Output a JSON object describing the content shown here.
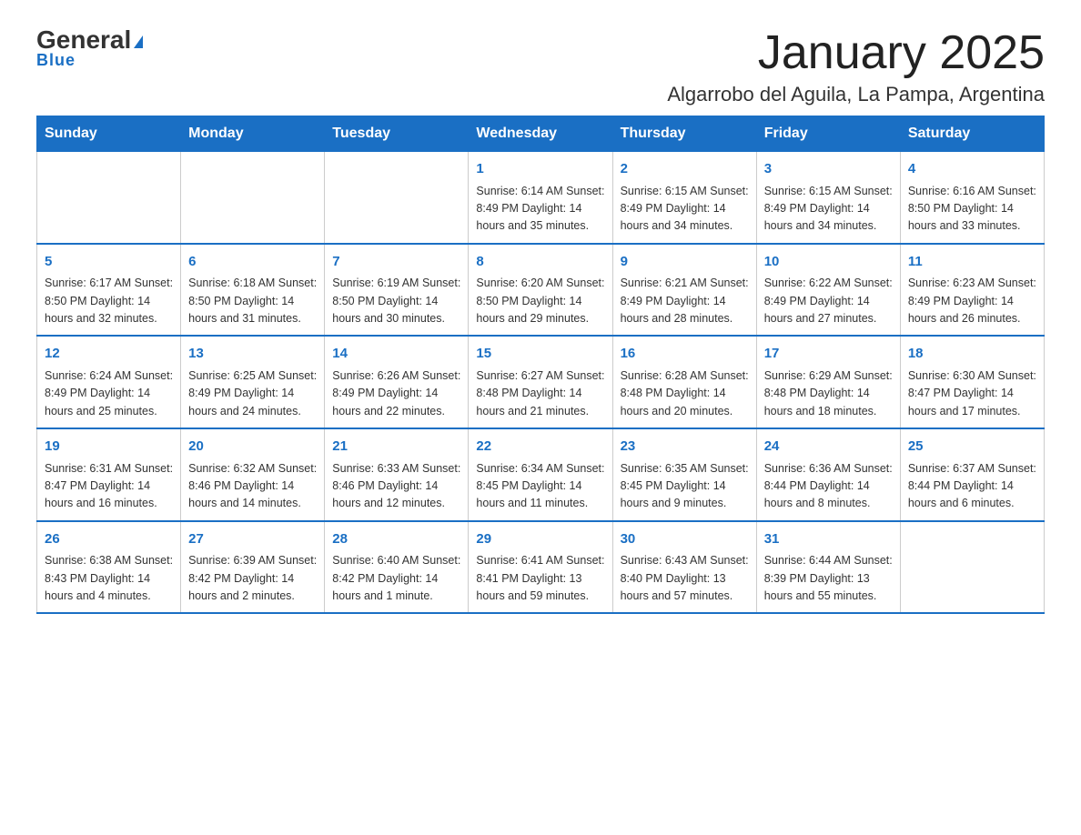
{
  "header": {
    "logo_general": "General",
    "logo_blue": "Blue",
    "title": "January 2025",
    "subtitle": "Algarrobo del Aguila, La Pampa, Argentina"
  },
  "days_of_week": [
    "Sunday",
    "Monday",
    "Tuesday",
    "Wednesday",
    "Thursday",
    "Friday",
    "Saturday"
  ],
  "weeks": [
    [
      {
        "day": "",
        "info": ""
      },
      {
        "day": "",
        "info": ""
      },
      {
        "day": "",
        "info": ""
      },
      {
        "day": "1",
        "info": "Sunrise: 6:14 AM\nSunset: 8:49 PM\nDaylight: 14 hours\nand 35 minutes."
      },
      {
        "day": "2",
        "info": "Sunrise: 6:15 AM\nSunset: 8:49 PM\nDaylight: 14 hours\nand 34 minutes."
      },
      {
        "day": "3",
        "info": "Sunrise: 6:15 AM\nSunset: 8:49 PM\nDaylight: 14 hours\nand 34 minutes."
      },
      {
        "day": "4",
        "info": "Sunrise: 6:16 AM\nSunset: 8:50 PM\nDaylight: 14 hours\nand 33 minutes."
      }
    ],
    [
      {
        "day": "5",
        "info": "Sunrise: 6:17 AM\nSunset: 8:50 PM\nDaylight: 14 hours\nand 32 minutes."
      },
      {
        "day": "6",
        "info": "Sunrise: 6:18 AM\nSunset: 8:50 PM\nDaylight: 14 hours\nand 31 minutes."
      },
      {
        "day": "7",
        "info": "Sunrise: 6:19 AM\nSunset: 8:50 PM\nDaylight: 14 hours\nand 30 minutes."
      },
      {
        "day": "8",
        "info": "Sunrise: 6:20 AM\nSunset: 8:50 PM\nDaylight: 14 hours\nand 29 minutes."
      },
      {
        "day": "9",
        "info": "Sunrise: 6:21 AM\nSunset: 8:49 PM\nDaylight: 14 hours\nand 28 minutes."
      },
      {
        "day": "10",
        "info": "Sunrise: 6:22 AM\nSunset: 8:49 PM\nDaylight: 14 hours\nand 27 minutes."
      },
      {
        "day": "11",
        "info": "Sunrise: 6:23 AM\nSunset: 8:49 PM\nDaylight: 14 hours\nand 26 minutes."
      }
    ],
    [
      {
        "day": "12",
        "info": "Sunrise: 6:24 AM\nSunset: 8:49 PM\nDaylight: 14 hours\nand 25 minutes."
      },
      {
        "day": "13",
        "info": "Sunrise: 6:25 AM\nSunset: 8:49 PM\nDaylight: 14 hours\nand 24 minutes."
      },
      {
        "day": "14",
        "info": "Sunrise: 6:26 AM\nSunset: 8:49 PM\nDaylight: 14 hours\nand 22 minutes."
      },
      {
        "day": "15",
        "info": "Sunrise: 6:27 AM\nSunset: 8:48 PM\nDaylight: 14 hours\nand 21 minutes."
      },
      {
        "day": "16",
        "info": "Sunrise: 6:28 AM\nSunset: 8:48 PM\nDaylight: 14 hours\nand 20 minutes."
      },
      {
        "day": "17",
        "info": "Sunrise: 6:29 AM\nSunset: 8:48 PM\nDaylight: 14 hours\nand 18 minutes."
      },
      {
        "day": "18",
        "info": "Sunrise: 6:30 AM\nSunset: 8:47 PM\nDaylight: 14 hours\nand 17 minutes."
      }
    ],
    [
      {
        "day": "19",
        "info": "Sunrise: 6:31 AM\nSunset: 8:47 PM\nDaylight: 14 hours\nand 16 minutes."
      },
      {
        "day": "20",
        "info": "Sunrise: 6:32 AM\nSunset: 8:46 PM\nDaylight: 14 hours\nand 14 minutes."
      },
      {
        "day": "21",
        "info": "Sunrise: 6:33 AM\nSunset: 8:46 PM\nDaylight: 14 hours\nand 12 minutes."
      },
      {
        "day": "22",
        "info": "Sunrise: 6:34 AM\nSunset: 8:45 PM\nDaylight: 14 hours\nand 11 minutes."
      },
      {
        "day": "23",
        "info": "Sunrise: 6:35 AM\nSunset: 8:45 PM\nDaylight: 14 hours\nand 9 minutes."
      },
      {
        "day": "24",
        "info": "Sunrise: 6:36 AM\nSunset: 8:44 PM\nDaylight: 14 hours\nand 8 minutes."
      },
      {
        "day": "25",
        "info": "Sunrise: 6:37 AM\nSunset: 8:44 PM\nDaylight: 14 hours\nand 6 minutes."
      }
    ],
    [
      {
        "day": "26",
        "info": "Sunrise: 6:38 AM\nSunset: 8:43 PM\nDaylight: 14 hours\nand 4 minutes."
      },
      {
        "day": "27",
        "info": "Sunrise: 6:39 AM\nSunset: 8:42 PM\nDaylight: 14 hours\nand 2 minutes."
      },
      {
        "day": "28",
        "info": "Sunrise: 6:40 AM\nSunset: 8:42 PM\nDaylight: 14 hours\nand 1 minute."
      },
      {
        "day": "29",
        "info": "Sunrise: 6:41 AM\nSunset: 8:41 PM\nDaylight: 13 hours\nand 59 minutes."
      },
      {
        "day": "30",
        "info": "Sunrise: 6:43 AM\nSunset: 8:40 PM\nDaylight: 13 hours\nand 57 minutes."
      },
      {
        "day": "31",
        "info": "Sunrise: 6:44 AM\nSunset: 8:39 PM\nDaylight: 13 hours\nand 55 minutes."
      },
      {
        "day": "",
        "info": ""
      }
    ]
  ]
}
